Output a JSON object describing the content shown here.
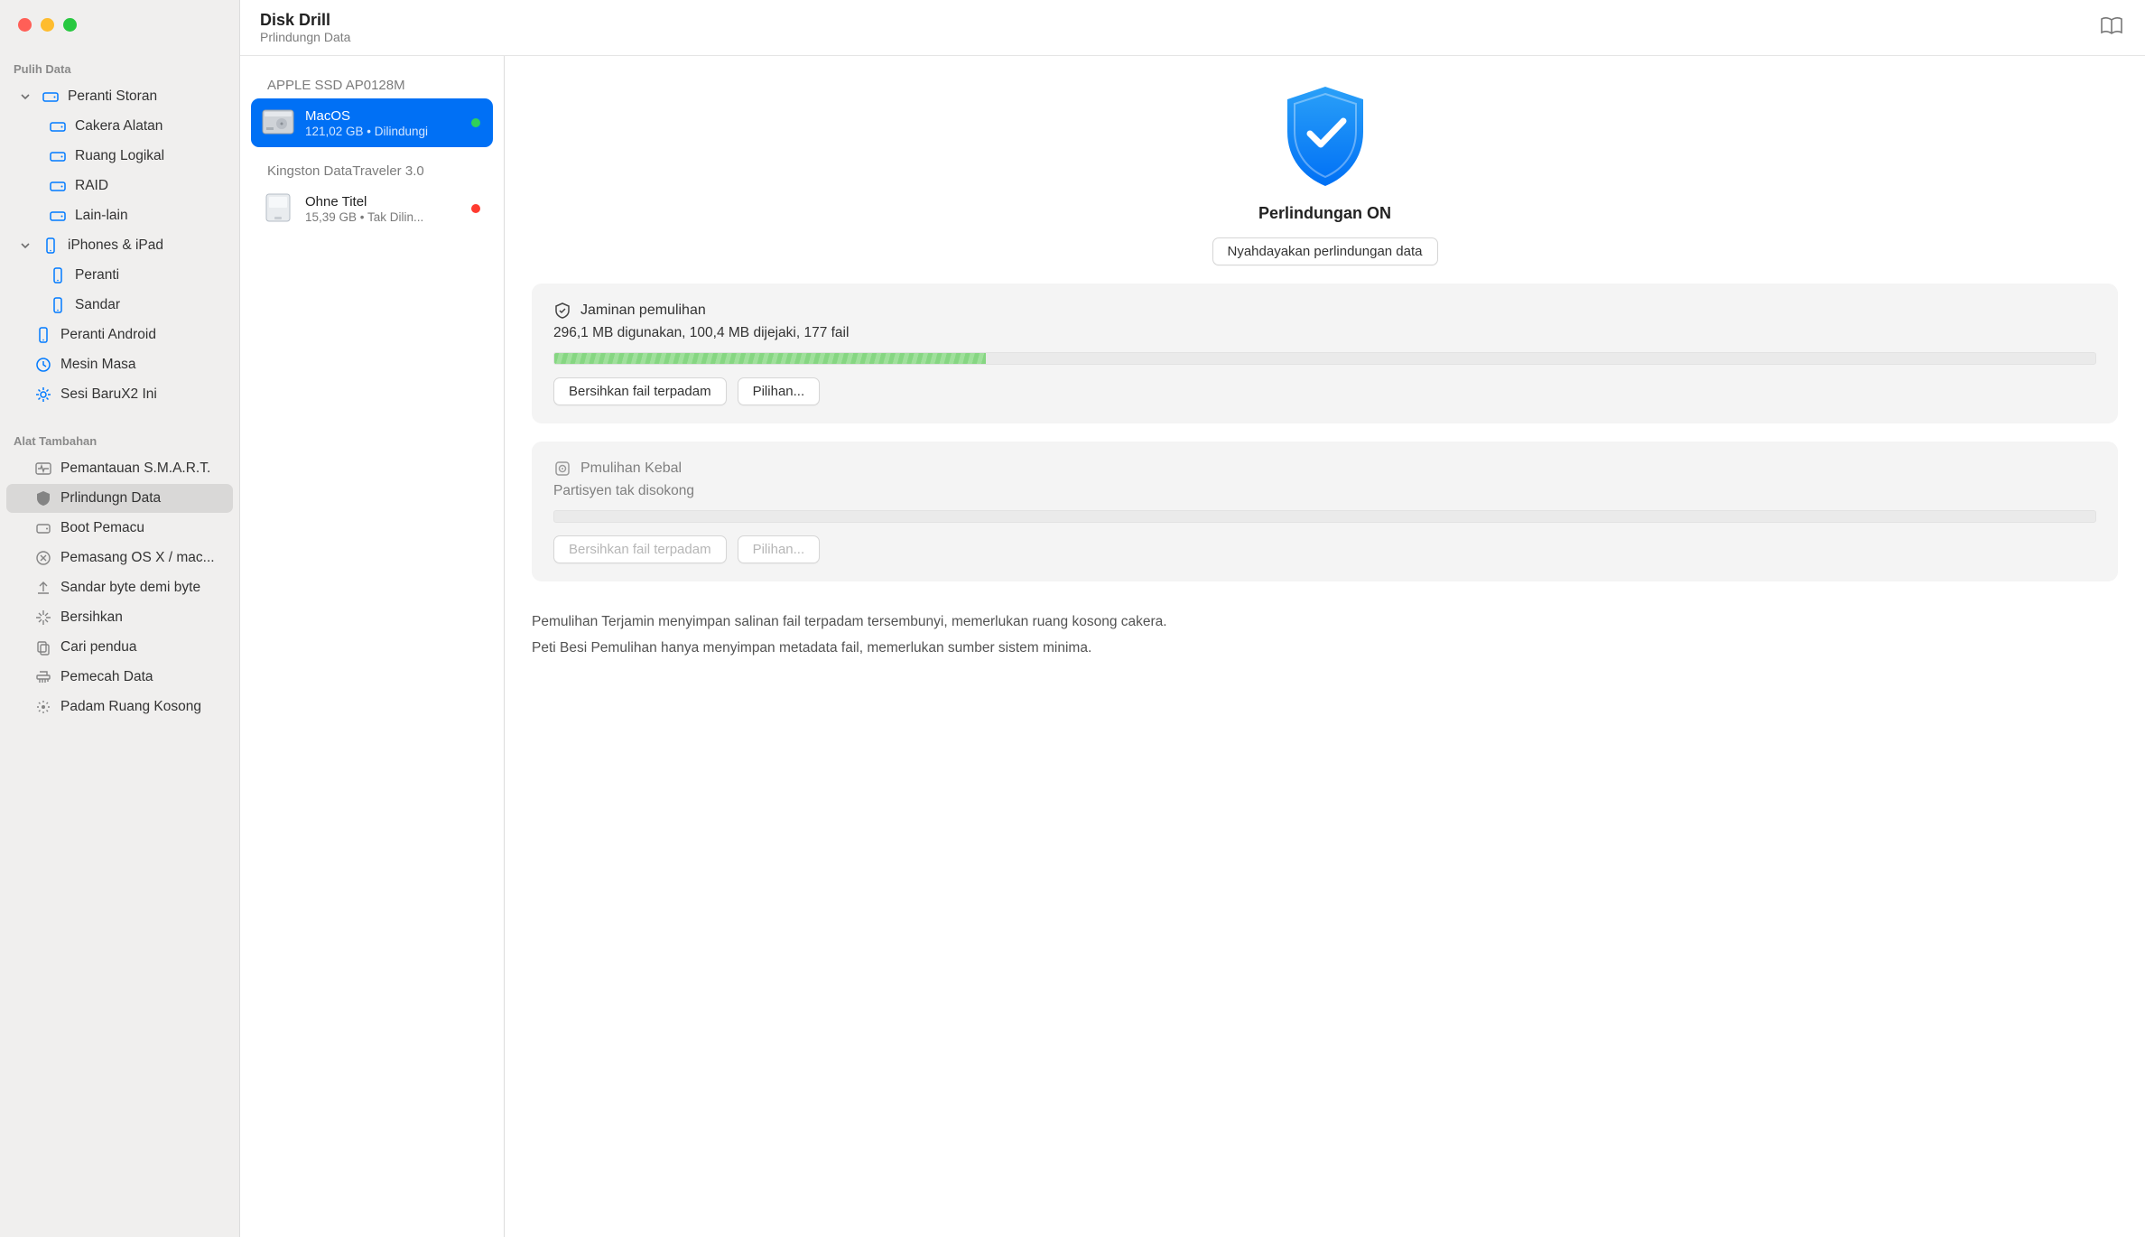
{
  "header": {
    "title": "Disk Drill",
    "subtitle": "Prlindungn Data"
  },
  "sidebar": {
    "section1": "Pulih Data",
    "storage_devices": "Peranti Storan",
    "storage_children": [
      "Cakera Alatan",
      "Ruang Logikal",
      "RAID",
      "Lain-lain"
    ],
    "iphones_ipad": "iPhones & iPad",
    "iphones_children": [
      "Peranti",
      "Sandar"
    ],
    "android": "Peranti Android",
    "time_machine": "Mesin Masa",
    "new_session": "Sesi BaruX2 Ini",
    "section2": "Alat Tambahan",
    "tools": [
      "Pemantauan S.M.A.R.T.",
      "Prlindungn Data",
      "Boot Pemacu",
      "Pemasang OS X / mac...",
      "Sandar byte demi byte",
      "Bersihkan",
      "Cari pendua",
      "Pemecah Data",
      "Padam Ruang Kosong"
    ]
  },
  "middle": {
    "group1": "APPLE SSD AP0128M",
    "drive1": {
      "name": "MacOS",
      "sub": "121,02 GB • Dilindungi"
    },
    "group2": "Kingston DataTraveler 3.0",
    "drive2": {
      "name": "Ohne Titel",
      "sub": "15,39 GB • Tak Dilin..."
    }
  },
  "main": {
    "protection_status": "Perlindungan ON",
    "disable_btn": "Nyahdayakan perlindungan data",
    "panel1": {
      "title": "Jaminan pemulihan",
      "sub": "296,1 MB digunakan, 100,4 MB dijejaki, 177 fail",
      "btn1": "Bersihkan fail terpadam",
      "btn2": "Pilihan..."
    },
    "panel2": {
      "title": "Pmulihan Kebal",
      "sub": "Partisyen tak disokong",
      "btn1": "Bersihkan fail terpadam",
      "btn2": "Pilihan..."
    },
    "desc1": "Pemulihan Terjamin menyimpan salinan fail terpadam tersembunyi, memerlukan ruang kosong cakera.",
    "desc2": "Peti Besi Pemulihan hanya menyimpan metadata fail, memerlukan sumber sistem minima."
  }
}
